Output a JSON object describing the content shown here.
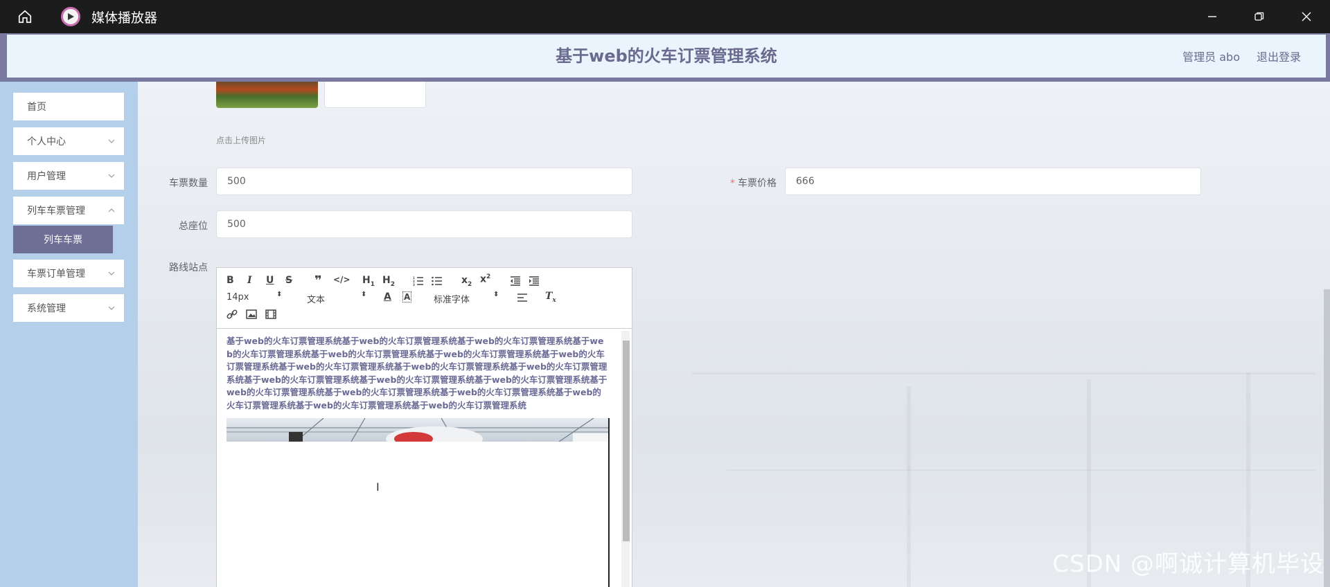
{
  "window": {
    "title": "媒体播放器"
  },
  "header": {
    "title": "基于web的火车订票管理系统",
    "user": "管理员 abo",
    "logout": "退出登录"
  },
  "sidebar": {
    "items": [
      {
        "label": "首页"
      },
      {
        "label": "个人中心"
      },
      {
        "label": "用户管理"
      },
      {
        "label": "列车车票管理"
      },
      {
        "label": "车票订单管理"
      },
      {
        "label": "系统管理"
      }
    ],
    "sub_item": "列车车票"
  },
  "form": {
    "upload_tip": "点击上传图片",
    "ticket_count_label": "车票数量",
    "ticket_count_value": "500",
    "ticket_price_label": "车票价格",
    "ticket_price_value": "666",
    "total_seats_label": "总座位",
    "total_seats_value": "500",
    "route_label": "路线站点"
  },
  "editor": {
    "font_size": "14px",
    "block_type": "文本",
    "font_family": "标准字体",
    "content": "基于web的火车订票管理系统基于web的火车订票管理系统基于web的火车订票管理系统基于web的火车订票管理系统基于web的火车订票管理系统基于web的火车订票管理系统基于web的火车订票管理系统基于web的火车订票管理系统基于web的火车订票管理系统基于web的火车订票管理系统基于web的火车订票管理系统基于web的火车订票管理系统基于web的火车订票管理系统基于web的火车订票管理系统基于web的火车订票管理系统基于web的火车订票管理系统基于web的火车订票管理系统基于web的火车订票管理系统基于web的火车订票管理系统"
  },
  "watermark": "CSDN @啊诚计算机毕设"
}
